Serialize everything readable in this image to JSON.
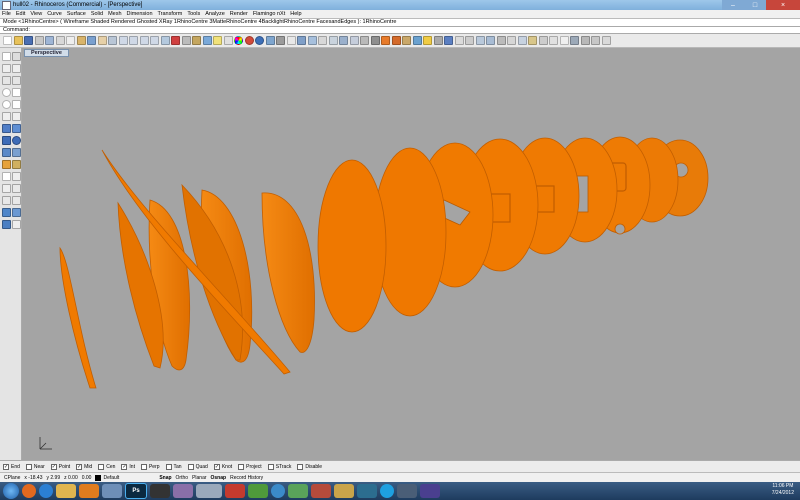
{
  "window": {
    "title": "hull02 - Rhinoceros (Commercial) - [Perspective]",
    "icon": "rhino-icon"
  },
  "menu": [
    "File",
    "Edit",
    "View",
    "Curve",
    "Surface",
    "Solid",
    "Mesh",
    "Dimension",
    "Transform",
    "Tools",
    "Analyze",
    "Render",
    "Flamingo nXt",
    "Help"
  ],
  "command_history": "Mode <1RhinoCentre> ( Wireframe  Shaded  Rendered  Ghosted  XRay  1RhinoCentre  3MatteRhinoCentre  4BacklightRhinoCentre  FacesandEdges ): 1RhinoCentre",
  "command_prompt": "Command:",
  "viewport": {
    "label": "Perspective",
    "background": "#a4a4a4",
    "object_color": "#ee7800",
    "axis_icon": "xyz-axis-icon"
  },
  "osnaps": [
    {
      "label": "End",
      "checked": true
    },
    {
      "label": "Near",
      "checked": false
    },
    {
      "label": "Point",
      "checked": true
    },
    {
      "label": "Mid",
      "checked": true
    },
    {
      "label": "Cen",
      "checked": false
    },
    {
      "label": "Int",
      "checked": true
    },
    {
      "label": "Perp",
      "checked": false
    },
    {
      "label": "Tan",
      "checked": false
    },
    {
      "label": "Quad",
      "checked": false
    },
    {
      "label": "Knot",
      "checked": true
    },
    {
      "label": "Project",
      "checked": false
    },
    {
      "label": "STrack",
      "checked": false
    },
    {
      "label": "Disable",
      "checked": false
    }
  ],
  "status": {
    "cplane": "CPlane",
    "x": "x -18.43",
    "y": "y 2.99",
    "z": "z 0.00",
    "units": "0.00",
    "layer": "Default",
    "snap": "Snap",
    "ortho": "Ortho",
    "planar": "Planar",
    "osnap": "Osnap",
    "history": "Record History"
  },
  "taskbar": {
    "time": "11:06 PM",
    "date": "7/24/2012",
    "ps_label": "Ps"
  },
  "colors": {
    "titlebar": "#8fbbe3",
    "taskbar": "#2a4a70",
    "orange": "#ee7800"
  }
}
